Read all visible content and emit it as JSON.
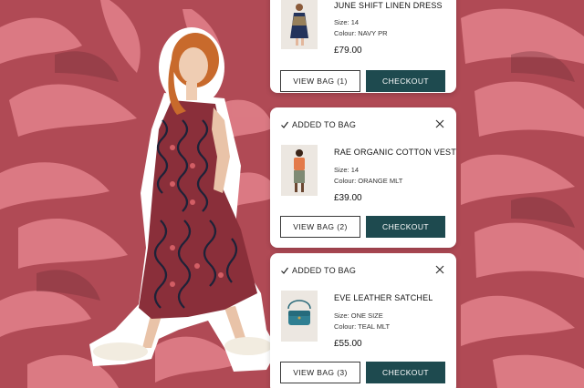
{
  "colors": {
    "background": "#b04a55",
    "pattern": "#e07f88",
    "checkout": "#1e4a4f",
    "card": "#ffffff",
    "dress_base": "#8a2f3a",
    "dress_pattern": "#1d2238"
  },
  "icons": {
    "tick": "checkmark-icon",
    "close": "close-icon"
  },
  "cards": [
    {
      "added_label": "",
      "product_name": "JUNE SHIFT LINEN DRESS",
      "size": "Size: 14",
      "colour": "Colour: NAVY PR",
      "price": "£79.00",
      "view_bag": "VIEW BAG (1)",
      "checkout": "CHECKOUT"
    },
    {
      "added_label": "ADDED TO BAG",
      "product_name": "RAE ORGANIC COTTON VEST",
      "size": "Size: 14",
      "colour": "Colour: ORANGE MLT",
      "price": "£39.00",
      "view_bag": "VIEW BAG (2)",
      "checkout": "CHECKOUT"
    },
    {
      "added_label": "ADDED TO BAG",
      "product_name": "EVE LEATHER SATCHEL",
      "size": "Size: ONE SIZE",
      "colour": "Colour: TEAL MLT",
      "price": "£55.00",
      "view_bag": "VIEW BAG (3)",
      "checkout": "CHECKOUT"
    }
  ]
}
